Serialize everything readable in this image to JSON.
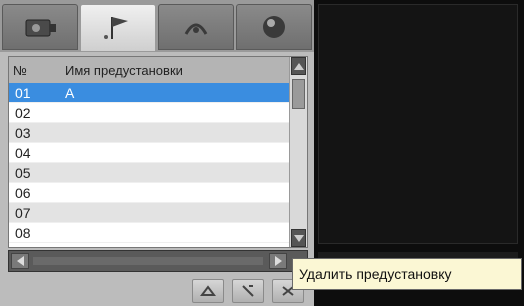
{
  "tabs": [
    {
      "icon": "camera-icon",
      "active": false
    },
    {
      "icon": "flag-icon",
      "active": true
    },
    {
      "icon": "tour-icon",
      "active": false
    },
    {
      "icon": "sphere-icon",
      "active": false
    }
  ],
  "table": {
    "headers": {
      "no": "№",
      "name": "Имя предустановки"
    },
    "rows": [
      {
        "no": "01",
        "name": "A",
        "selected": true
      },
      {
        "no": "02",
        "name": ""
      },
      {
        "no": "03",
        "name": ""
      },
      {
        "no": "04",
        "name": ""
      },
      {
        "no": "05",
        "name": ""
      },
      {
        "no": "06",
        "name": ""
      },
      {
        "no": "07",
        "name": ""
      },
      {
        "no": "08",
        "name": ""
      }
    ]
  },
  "toolbar": {
    "buttons": [
      "call-preset-icon",
      "set-preset-icon",
      "delete-preset-icon"
    ]
  },
  "tooltip": {
    "text": "Удалить предустановку"
  },
  "colors": {
    "selection": "#3a8de0",
    "tooltip_bg": "#fbf7d4"
  }
}
